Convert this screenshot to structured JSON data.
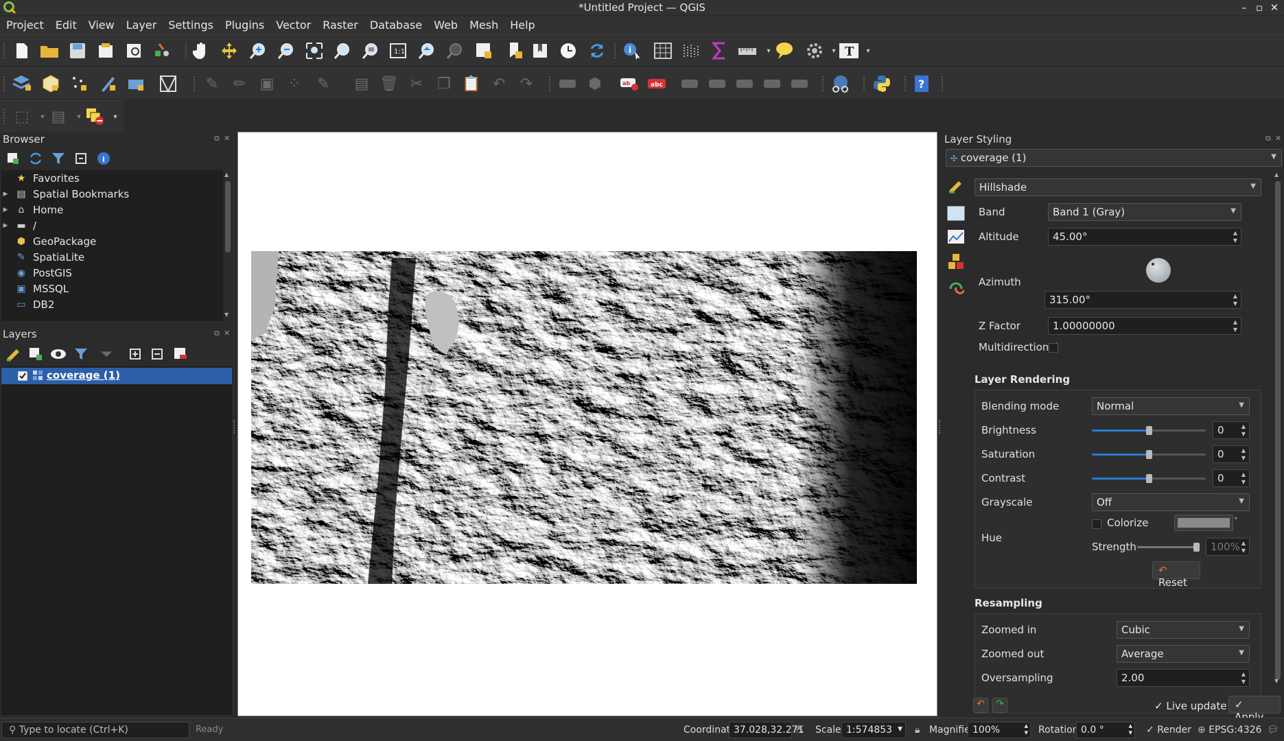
{
  "window": {
    "title": "*Untitled Project — QGIS"
  },
  "menu": [
    "Project",
    "Edit",
    "View",
    "Layer",
    "Settings",
    "Plugins",
    "Vector",
    "Raster",
    "Database",
    "Web",
    "Mesh",
    "Help"
  ],
  "browser": {
    "title": "Browser",
    "items": [
      {
        "label": "Favorites",
        "icon": "star-icon",
        "arrow": false
      },
      {
        "label": "Spatial Bookmarks",
        "icon": "bookmark-icon",
        "arrow": true
      },
      {
        "label": "Home",
        "icon": "home-folder-icon",
        "arrow": true
      },
      {
        "label": "/",
        "icon": "folder-icon",
        "arrow": true
      },
      {
        "label": "GeoPackage",
        "icon": "geopackage-icon",
        "arrow": false
      },
      {
        "label": "SpatiaLite",
        "icon": "spatialite-icon",
        "arrow": false
      },
      {
        "label": "PostGIS",
        "icon": "postgis-icon",
        "arrow": false
      },
      {
        "label": "MSSQL",
        "icon": "mssql-icon",
        "arrow": false
      },
      {
        "label": "DB2",
        "icon": "db2-icon",
        "arrow": false
      }
    ]
  },
  "layers": {
    "title": "Layers",
    "items": [
      {
        "label": "coverage (1)",
        "checked": true
      }
    ]
  },
  "styling": {
    "title": "Layer Styling",
    "layer_select": "coverage (1)",
    "renderer": "Hillshade",
    "band_label": "Band",
    "band_value": "Band 1 (Gray)",
    "altitude_label": "Altitude",
    "altitude_value": "45.00°",
    "azimuth_label": "Azimuth",
    "azimuth_value": "315.00°",
    "zfactor_label": "Z Factor",
    "zfactor_value": "1.00000000",
    "multidirectional_label": "Multidirectional",
    "rendering_section": "Layer Rendering",
    "blending_label": "Blending mode",
    "blending_value": "Normal",
    "brightness_label": "Brightness",
    "brightness_value": "0",
    "saturation_label": "Saturation",
    "saturation_value": "0",
    "contrast_label": "Contrast",
    "contrast_value": "0",
    "grayscale_label": "Grayscale",
    "grayscale_value": "Off",
    "hue_label": "Hue",
    "colorize_label": "Colorize",
    "strength_label": "Strength",
    "strength_value": "100%",
    "reset_label": "Reset",
    "resampling_section": "Resampling",
    "zoomed_in_label": "Zoomed in",
    "zoomed_in_value": "Cubic",
    "zoomed_out_label": "Zoomed out",
    "zoomed_out_value": "Average",
    "oversampling_label": "Oversampling",
    "oversampling_value": "2.00",
    "live_update_label": "Live update",
    "apply_label": "Apply"
  },
  "status": {
    "locator_placeholder": "Type to locate (Ctrl+K)",
    "ready": "Ready",
    "coordinate_label": "Coordinate",
    "coordinate_value": "37.028,32.271",
    "scale_label": "Scale",
    "scale_value": "1:574853",
    "magnifier_label": "Magnifier",
    "magnifier_value": "100%",
    "rotation_label": "Rotation",
    "rotation_value": "0.0 °",
    "render_label": "Render",
    "crs": "EPSG:4326"
  },
  "colors": {
    "accent": "#2a7ad6",
    "selection": "#2d5fa8",
    "canvas": "#ffffff"
  }
}
